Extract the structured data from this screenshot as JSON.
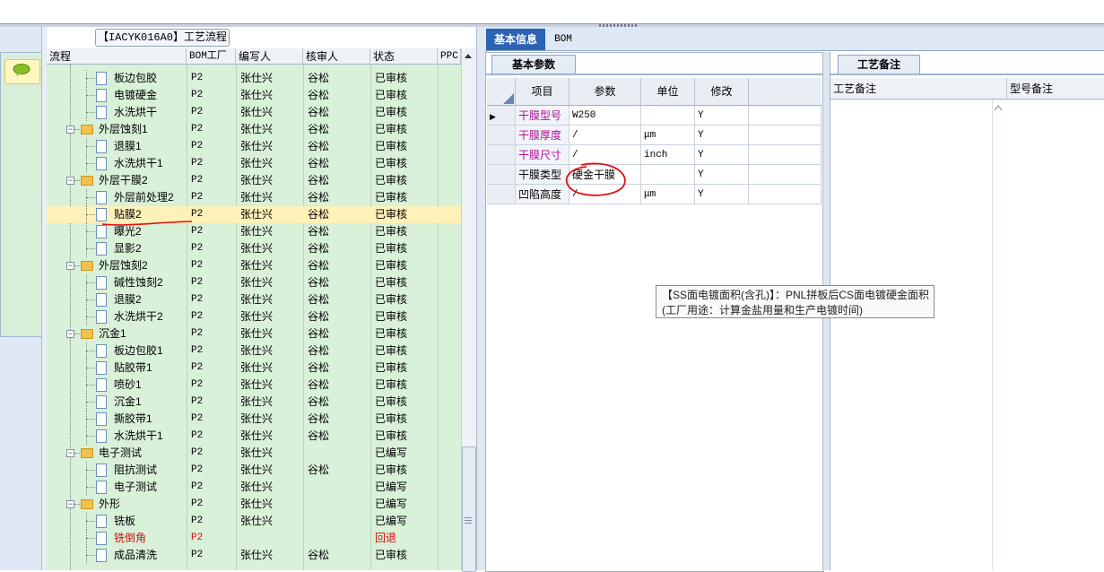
{
  "process_panel": {
    "title": "【IACYK016A0】工艺流程",
    "columns": [
      "流程",
      "BOM工厂",
      "编写人",
      "核审人",
      "状态",
      "PPC"
    ],
    "rows": [
      {
        "name": "板边包胶",
        "factory": "P2",
        "writer": "张仕兴",
        "reviewer": "谷松",
        "status": "已审核",
        "type": "doc",
        "level": 2
      },
      {
        "name": "电镀硬金",
        "factory": "P2",
        "writer": "张仕兴",
        "reviewer": "谷松",
        "status": "已审核",
        "type": "doc",
        "level": 2
      },
      {
        "name": "水洗烘干",
        "factory": "P2",
        "writer": "张仕兴",
        "reviewer": "谷松",
        "status": "已审核",
        "type": "doc",
        "level": 2
      },
      {
        "name": "外层蚀刻1",
        "factory": "P2",
        "writer": "张仕兴",
        "reviewer": "谷松",
        "status": "已审核",
        "type": "folder",
        "level": 1
      },
      {
        "name": "退膜1",
        "factory": "P2",
        "writer": "张仕兴",
        "reviewer": "谷松",
        "status": "已审核",
        "type": "doc",
        "level": 2
      },
      {
        "name": "水洗烘干1",
        "factory": "P2",
        "writer": "张仕兴",
        "reviewer": "谷松",
        "status": "已审核",
        "type": "doc",
        "level": 2
      },
      {
        "name": "外层干膜2",
        "factory": "P2",
        "writer": "张仕兴",
        "reviewer": "谷松",
        "status": "已审核",
        "type": "folder",
        "level": 1
      },
      {
        "name": "外层前处理2",
        "factory": "P2",
        "writer": "张仕兴",
        "reviewer": "谷松",
        "status": "已审核",
        "type": "doc",
        "level": 2
      },
      {
        "name": "贴膜2",
        "factory": "P2",
        "writer": "张仕兴",
        "reviewer": "谷松",
        "status": "已审核",
        "type": "doc",
        "level": 2,
        "selected": true
      },
      {
        "name": "曝光2",
        "factory": "P2",
        "writer": "张仕兴",
        "reviewer": "谷松",
        "status": "已审核",
        "type": "doc",
        "level": 2
      },
      {
        "name": "显影2",
        "factory": "P2",
        "writer": "张仕兴",
        "reviewer": "谷松",
        "status": "已审核",
        "type": "doc",
        "level": 2
      },
      {
        "name": "外层蚀刻2",
        "factory": "P2",
        "writer": "张仕兴",
        "reviewer": "谷松",
        "status": "已审核",
        "type": "folder",
        "level": 1
      },
      {
        "name": "碱性蚀刻2",
        "factory": "P2",
        "writer": "张仕兴",
        "reviewer": "谷松",
        "status": "已审核",
        "type": "doc",
        "level": 2
      },
      {
        "name": "退膜2",
        "factory": "P2",
        "writer": "张仕兴",
        "reviewer": "谷松",
        "status": "已审核",
        "type": "doc",
        "level": 2
      },
      {
        "name": "水洗烘干2",
        "factory": "P2",
        "writer": "张仕兴",
        "reviewer": "谷松",
        "status": "已审核",
        "type": "doc",
        "level": 2
      },
      {
        "name": "沉金1",
        "factory": "P2",
        "writer": "张仕兴",
        "reviewer": "谷松",
        "status": "已审核",
        "type": "folder",
        "level": 1
      },
      {
        "name": "板边包胶1",
        "factory": "P2",
        "writer": "张仕兴",
        "reviewer": "谷松",
        "status": "已审核",
        "type": "doc",
        "level": 2
      },
      {
        "name": "贴胶带1",
        "factory": "P2",
        "writer": "张仕兴",
        "reviewer": "谷松",
        "status": "已审核",
        "type": "doc",
        "level": 2
      },
      {
        "name": "喷砂1",
        "factory": "P2",
        "writer": "张仕兴",
        "reviewer": "谷松",
        "status": "已审核",
        "type": "doc",
        "level": 2
      },
      {
        "name": "沉金1",
        "factory": "P2",
        "writer": "张仕兴",
        "reviewer": "谷松",
        "status": "已审核",
        "type": "doc",
        "level": 2
      },
      {
        "name": "撕胶带1",
        "factory": "P2",
        "writer": "张仕兴",
        "reviewer": "谷松",
        "status": "已审核",
        "type": "doc",
        "level": 2
      },
      {
        "name": "水洗烘干1",
        "factory": "P2",
        "writer": "张仕兴",
        "reviewer": "谷松",
        "status": "已审核",
        "type": "doc",
        "level": 2
      },
      {
        "name": "电子测试",
        "factory": "P2",
        "writer": "张仕兴",
        "reviewer": "",
        "status": "已编写",
        "type": "folder",
        "level": 1
      },
      {
        "name": "阻抗测试",
        "factory": "P2",
        "writer": "张仕兴",
        "reviewer": "谷松",
        "status": "已审核",
        "type": "doc",
        "level": 2
      },
      {
        "name": "电子测试",
        "factory": "P2",
        "writer": "张仕兴",
        "reviewer": "",
        "status": "已编写",
        "type": "doc",
        "level": 2
      },
      {
        "name": "外形",
        "factory": "P2",
        "writer": "张仕兴",
        "reviewer": "",
        "status": "已编写",
        "type": "folder",
        "level": 1
      },
      {
        "name": "铣板",
        "factory": "P2",
        "writer": "张仕兴",
        "reviewer": "",
        "status": "已编写",
        "type": "doc",
        "level": 2
      },
      {
        "name": "铣倒角",
        "factory": "P2",
        "writer": "",
        "reviewer": "",
        "status": "回退",
        "type": "doc",
        "level": 2,
        "red": true
      },
      {
        "name": "成品清洗",
        "factory": "P2",
        "writer": "张仕兴",
        "reviewer": "谷松",
        "status": "已审核",
        "type": "doc",
        "level": 2
      }
    ]
  },
  "main_tabs": {
    "basic": "基本信息",
    "bom": "BOM"
  },
  "param_panel": {
    "tab": "基本参数",
    "columns": [
      "项目",
      "参数",
      "单位",
      "修改"
    ],
    "rows": [
      {
        "item": "干膜型号",
        "value": "W250",
        "unit": "",
        "modify": "Y",
        "color": "#b0109b"
      },
      {
        "item": "干膜厚度",
        "value": "/",
        "unit": "μm",
        "modify": "Y",
        "color": "#b0109b"
      },
      {
        "item": "干膜尺寸",
        "value": "/",
        "unit": "inch",
        "modify": "Y",
        "color": "#b0109b"
      },
      {
        "item": "干膜类型",
        "value": "硬金干膜",
        "unit": "",
        "modify": "Y",
        "color": "#000000"
      },
      {
        "item": "凹陷高度",
        "value": "/",
        "unit": "μm",
        "modify": "Y",
        "color": "#000000"
      }
    ]
  },
  "remark_panel": {
    "tab": "工艺备注",
    "columns": [
      "工艺备注",
      "型号备注"
    ]
  },
  "tooltip": {
    "line1": "【SS面电镀面积(含孔)】：PNL拼板后CS面电镀硬金面积",
    "line2": "(工厂用途：计算金盐用量和生产电镀时间)"
  },
  "colors": {
    "accent": "#2b63b5",
    "tree_bg": "#d9f0d9",
    "selected_row": "#fff1b8",
    "annotation": "#e01010"
  }
}
